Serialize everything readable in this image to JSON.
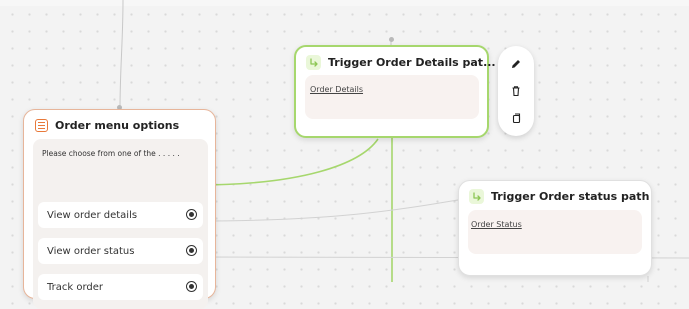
{
  "canvas": {
    "accent_green": "#a6d76d",
    "accent_orange": "#e8793a"
  },
  "menu_node": {
    "title": "Order menu options",
    "icon": "list-icon",
    "prompt": "Please choose from one of the . . . . .",
    "options": [
      {
        "label": "View order details"
      },
      {
        "label": "View order status"
      },
      {
        "label": "Track order"
      }
    ]
  },
  "details_node": {
    "title": "Trigger Order Details pat...",
    "icon": "trigger-arrow-icon",
    "link": "Order Details"
  },
  "status_node": {
    "title": "Trigger Order status path",
    "icon": "trigger-arrow-icon",
    "link": "Order Status"
  },
  "toolbar": {
    "actions": [
      {
        "name": "edit",
        "icon": "pencil-icon"
      },
      {
        "name": "delete",
        "icon": "trash-icon"
      },
      {
        "name": "duplicate",
        "icon": "copy-icon"
      }
    ]
  }
}
